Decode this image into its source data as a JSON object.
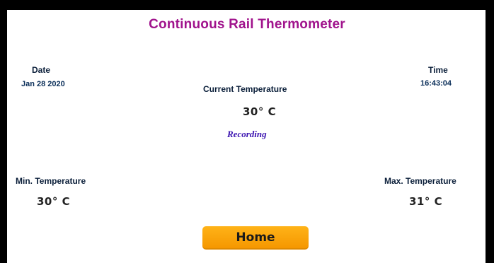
{
  "title": "Continuous Rail Thermometer",
  "date": {
    "label": "Date",
    "value": "Jan 28 2020"
  },
  "time": {
    "label": "Time",
    "value": "16:43:04"
  },
  "current": {
    "label": "Current Temperature",
    "value": "30° C"
  },
  "status": "Recording",
  "min": {
    "label": "Min. Temperature",
    "value": "30° C"
  },
  "max": {
    "label": "Max. Temperature",
    "value": "31° C"
  },
  "home_button": "Home",
  "colors": {
    "title": "#a0128c",
    "status": "#3a12b0",
    "button": "#f59700",
    "frame": "#000000"
  }
}
